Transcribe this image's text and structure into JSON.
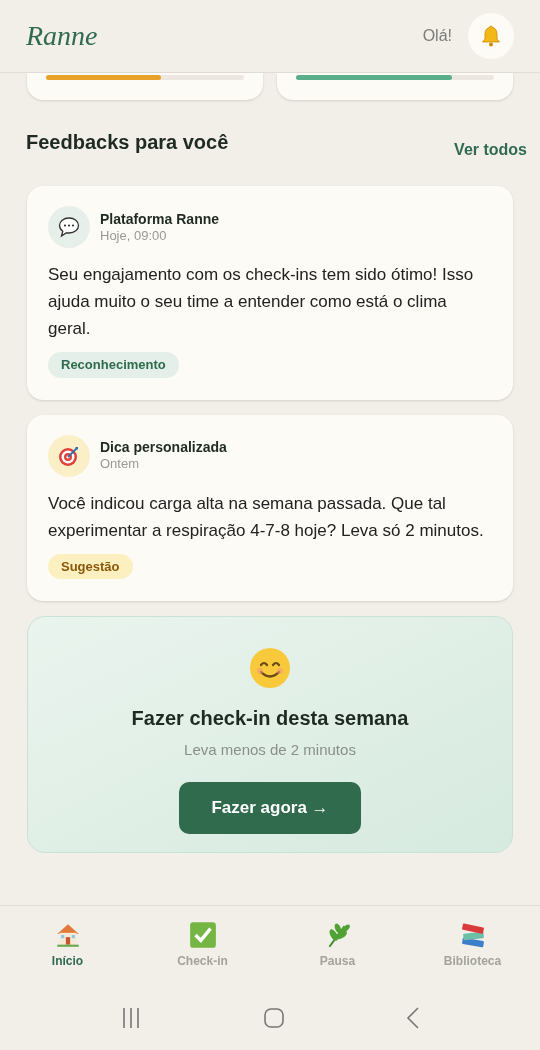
{
  "header": {
    "logo": "Ranne",
    "greeting": "Olá!"
  },
  "summary_cards": [
    {
      "level": 0.58,
      "color": "#e9a12a"
    },
    {
      "level": 0.79,
      "color": "#5aae8a"
    }
  ],
  "feedbacks": {
    "title": "Feedbacks para você",
    "link": "Ver todos",
    "items": [
      {
        "kind": "message",
        "sender": "Plataforma Ranne",
        "time": "Hoje, 09:00",
        "text": "Seu engajamento com os check-ins tem sido ótimo! Isso ajuda muito o seu time a entender como está o clima geral.",
        "tag": "Reconhecimento"
      },
      {
        "kind": "tip",
        "sender": "Dica personalizada",
        "time": "Ontem",
        "text": "Você indicou carga alta na semana passada. Que tal experimentar a respiração 4-7-8 hoje? Leva só 2 minutos.",
        "tag": "Sugestão"
      }
    ]
  },
  "checkin_card": {
    "title": "Fazer check-in desta semana",
    "subtitle": "Leva menos de 2 minutos",
    "button": "Fazer agora →"
  },
  "bottom_nav": [
    {
      "kind": "home",
      "label": "Início",
      "selected": true
    },
    {
      "kind": "check",
      "label": "Check-in",
      "selected": false
    },
    {
      "kind": "leaf",
      "label": "Pausa",
      "selected": false
    },
    {
      "kind": "books",
      "label": "Biblioteca",
      "selected": false
    }
  ]
}
